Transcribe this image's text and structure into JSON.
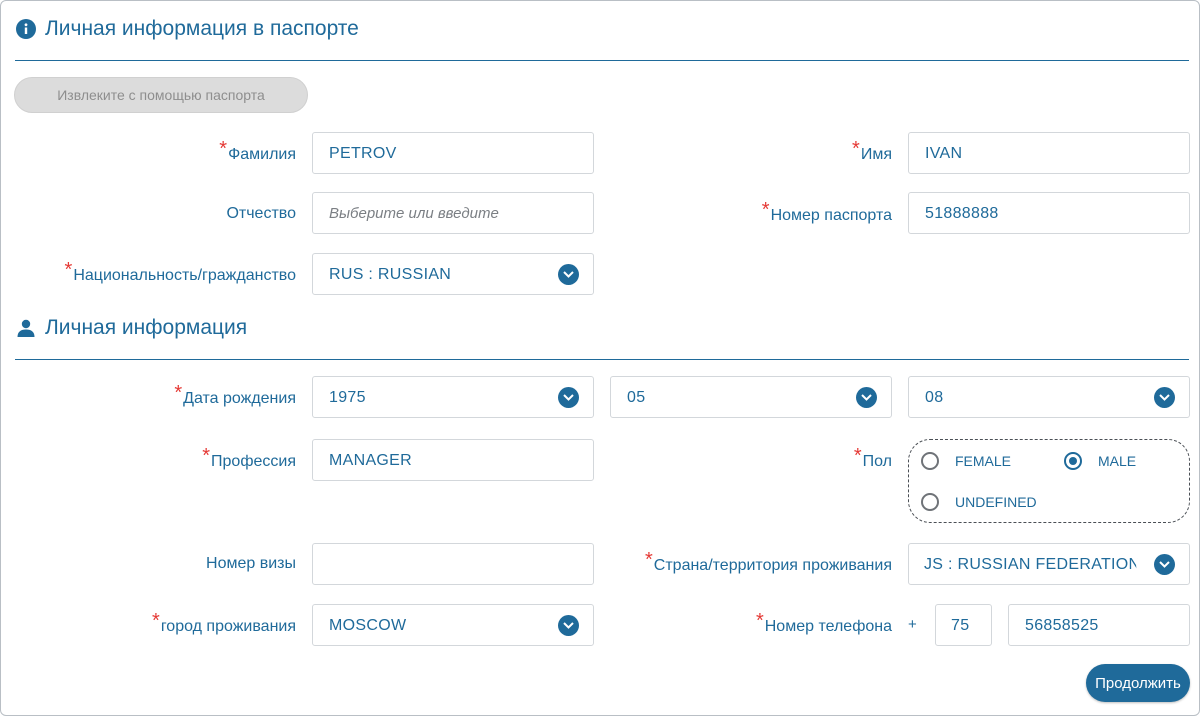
{
  "passport_section": {
    "title": "Личная информация в паспорте",
    "icon": "info-icon",
    "extract_button": "Извлеките с помощью паспорта",
    "surname": {
      "label": "Фамилия",
      "required_mark": "*",
      "value": "PETROV"
    },
    "first_name": {
      "label": "Имя",
      "required_mark": "*",
      "value": "IVAN"
    },
    "patronymic": {
      "label": "Отчество",
      "placeholder": "Выберите или введите",
      "value": ""
    },
    "passport_number": {
      "label": "Номер паспорта",
      "required_mark": "*",
      "value": "51888888"
    },
    "nationality": {
      "label": "Национальность/гражданство",
      "required_mark": "*",
      "value": "RUS : RUSSIAN"
    }
  },
  "personal_section": {
    "title": "Личная информация",
    "icon": "user-icon",
    "birth_date": {
      "label": "Дата рождения",
      "required_mark": "*",
      "year": "1975",
      "month": "05",
      "day": "08"
    },
    "profession": {
      "label": "Профессия",
      "required_mark": "*",
      "value": "MANAGER"
    },
    "gender": {
      "label": "Пол",
      "required_mark": "*",
      "options": [
        "FEMALE",
        "MALE",
        "UNDEFINED"
      ],
      "selected": "MALE"
    },
    "visa_number": {
      "label": "Номер визы",
      "value": ""
    },
    "residence_country": {
      "label": "Страна/территория проживания",
      "required_mark": "*",
      "value": "JS : RUSSIAN FEDERATION"
    },
    "residence_city": {
      "label": "город проживания",
      "required_mark": "*",
      "value": "MOSCOW"
    },
    "phone": {
      "label": "Номер телефона",
      "required_mark": "*",
      "plus": "+",
      "country_code": "75",
      "number": "56858525"
    }
  },
  "continue_button": "Продолжить",
  "colors": {
    "accent": "#1f6a9a",
    "required": "#e53935",
    "disabled_bg": "#dcdcdc"
  }
}
